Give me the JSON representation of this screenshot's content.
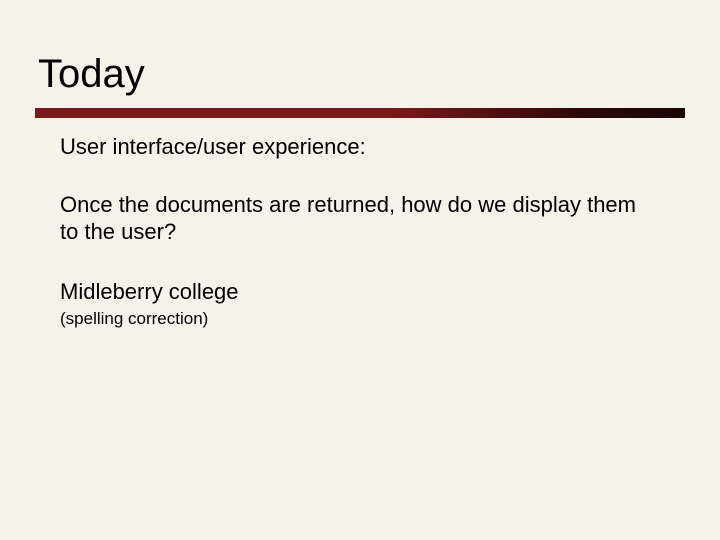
{
  "slide": {
    "title": "Today",
    "paragraphs": [
      "User interface/user experience:",
      "Once the documents are returned, how do we display them to the user?",
      "Midleberry college"
    ],
    "small_note": "(spelling correction)"
  }
}
